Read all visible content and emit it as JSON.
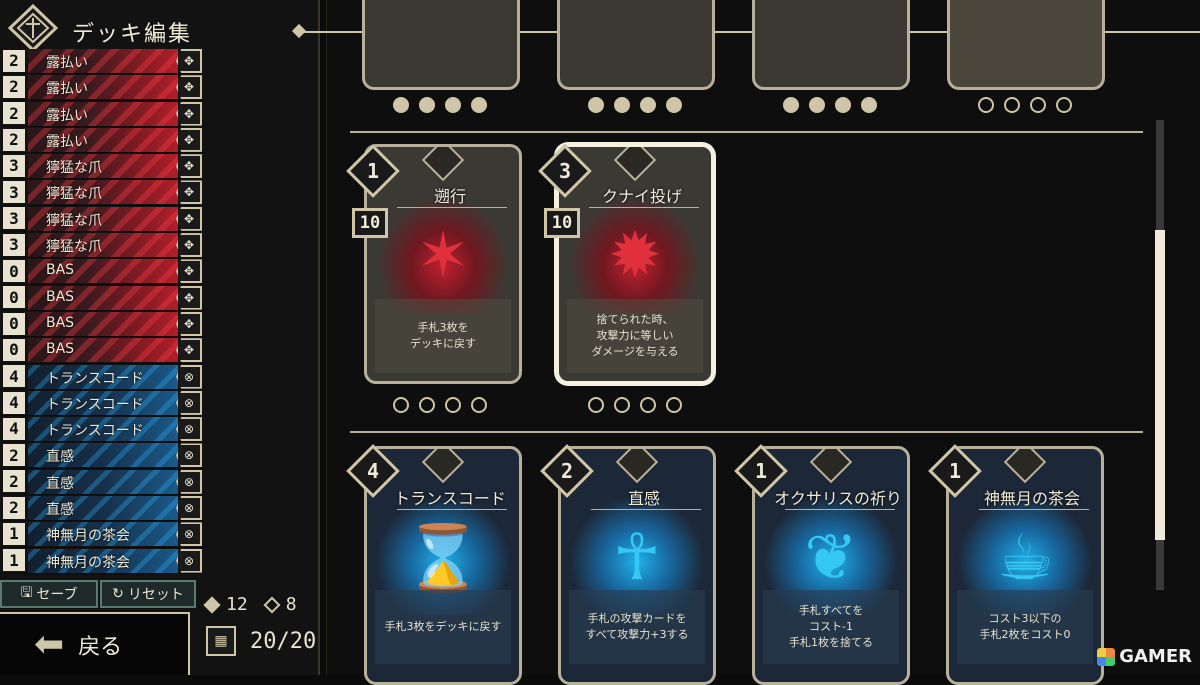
{
  "header": {
    "title": "デッキ編集"
  },
  "deck_list": [
    {
      "count": "2",
      "name": "露払い",
      "type": "red"
    },
    {
      "count": "2",
      "name": "露払い",
      "type": "red"
    },
    {
      "count": "2",
      "name": "露払い",
      "type": "red"
    },
    {
      "count": "2",
      "name": "露払い",
      "type": "red"
    },
    {
      "count": "3",
      "name": "獰猛な爪",
      "type": "red"
    },
    {
      "count": "3",
      "name": "獰猛な爪",
      "type": "red"
    },
    {
      "count": "3",
      "name": "獰猛な爪",
      "type": "red"
    },
    {
      "count": "3",
      "name": "獰猛な爪",
      "type": "red"
    },
    {
      "count": "0",
      "name": "BAS",
      "type": "red"
    },
    {
      "count": "0",
      "name": "BAS",
      "type": "red"
    },
    {
      "count": "0",
      "name": "BAS",
      "type": "red"
    },
    {
      "count": "0",
      "name": "BAS",
      "type": "red"
    },
    {
      "count": "4",
      "name": "トランスコード",
      "type": "blue"
    },
    {
      "count": "4",
      "name": "トランスコード",
      "type": "blue"
    },
    {
      "count": "4",
      "name": "トランスコード",
      "type": "blue"
    },
    {
      "count": "2",
      "name": "直感",
      "type": "blue"
    },
    {
      "count": "2",
      "name": "直感",
      "type": "blue"
    },
    {
      "count": "2",
      "name": "直感",
      "type": "blue"
    },
    {
      "count": "1",
      "name": "神無月の茶会",
      "type": "blue"
    },
    {
      "count": "1",
      "name": "神無月の茶会",
      "type": "blue"
    }
  ],
  "buttons": {
    "save": "セーブ",
    "reset": "リセット",
    "back": "戻る"
  },
  "stats": {
    "attack_count": "12",
    "skill_count": "8",
    "deck_total": "20/20"
  },
  "cards_row1": [
    {
      "cost": "1",
      "attack": "10",
      "title": "遡行",
      "desc": "手札3枚を\nデッキに戻す",
      "type": "red",
      "icon": "claw-slash-icon",
      "glyph": "✶"
    },
    {
      "cost": "3",
      "attack": "10",
      "title": "クナイ投げ",
      "desc": "捨てられた時、\n攻撃力に等しい\nダメージを与える",
      "type": "red",
      "icon": "kunai-burst-icon",
      "glyph": "✹"
    }
  ],
  "cards_row2": [
    {
      "cost": "4",
      "title": "トランスコード",
      "desc": "手札3枚をデッキに戻す",
      "type": "blue",
      "icon": "hourglass-icon",
      "glyph": "⌛"
    },
    {
      "cost": "2",
      "title": "直感",
      "desc": "手札の攻撃カードを\nすべて攻撃力+3する",
      "type": "blue",
      "icon": "girl-silhouette-icon",
      "glyph": "☥"
    },
    {
      "cost": "1",
      "title": "オクサリスの祈り",
      "desc": "手札すべてを\nコスト-1\n手札1枚を捨てる",
      "type": "blue",
      "icon": "winged-book-icon",
      "glyph": "❦"
    },
    {
      "cost": "1",
      "title": "神無月の茶会",
      "desc": "コスト3以下の\n手札2枚をコスト0",
      "type": "blue",
      "icon": "teacup-icon",
      "glyph": "☕"
    }
  ],
  "watermark": "GAMER",
  "colors": {
    "red_accent": "#b01f2a",
    "blue_accent": "#1a5a8a",
    "frame": "#b8b09a"
  }
}
